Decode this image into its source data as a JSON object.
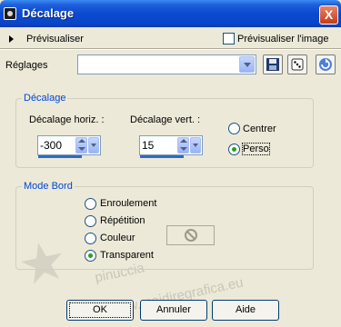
{
  "window": {
    "title": "Décalage",
    "close_label": "X"
  },
  "preview": {
    "label": "Prévisualiser",
    "checkbox_label": "Prévisualiser l'image",
    "checked": false
  },
  "presets": {
    "label": "Réglages",
    "value": ""
  },
  "offset_group": {
    "legend": "Décalage",
    "horiz_label": "Décalage horiz. :",
    "horiz_value": "-300",
    "vert_label": "Décalage vert. :",
    "vert_value": "15",
    "options": [
      {
        "label": "Centrer",
        "selected": false
      },
      {
        "label": "Perso",
        "selected": true
      }
    ]
  },
  "edge_group": {
    "legend": "Mode Bord",
    "options": [
      {
        "label": "Enroulement",
        "selected": false
      },
      {
        "label": "Répétition",
        "selected": false
      },
      {
        "label": "Couleur",
        "selected": false
      },
      {
        "label": "Transparent",
        "selected": true
      }
    ]
  },
  "buttons": {
    "ok": "OK",
    "cancel": "Annuler",
    "help": "Aide"
  },
  "watermark": {
    "brand": "pinuccia",
    "site": "www.maidiregrafica.eu"
  },
  "colors": {
    "title_blue": "#0a4ad0",
    "dialog_bg": "#ece9d8",
    "group_label": "#0046d5",
    "radio_dot": "#21a121"
  }
}
